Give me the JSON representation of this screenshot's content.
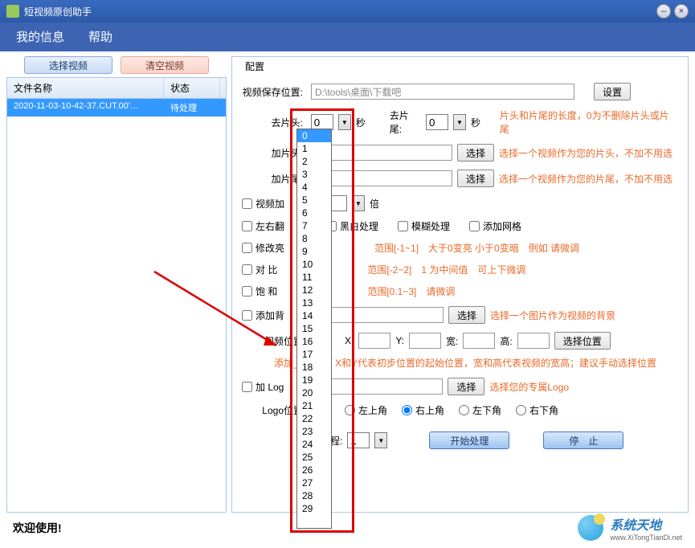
{
  "title": "短视频原创助手",
  "menu": {
    "info": "我的信息",
    "help": "帮助"
  },
  "leftButtons": {
    "select": "选择视频",
    "clear": "清空视频"
  },
  "fileTable": {
    "headers": {
      "name": "文件名称",
      "status": "状态"
    },
    "rows": [
      {
        "name": "2020-11-03-10-42-37.CUT.00'…",
        "status": "待处理"
      }
    ]
  },
  "config": {
    "groupTitle": "配置",
    "savePath": {
      "label": "视频保存位置:",
      "value": "D:\\tools\\桌面\\下载吧",
      "btn": "设置"
    },
    "trimHead": {
      "label": "去片头:",
      "value": "0",
      "unit": "秒"
    },
    "trimTail": {
      "label": "去片尾:",
      "value": "0",
      "unit": "秒",
      "hint": "片头和片尾的长度，0为不删除片头或片尾"
    },
    "addHead": {
      "label": "加片头:",
      "btn": "选择",
      "hint": "选择一个视频作为您的片头，不加不用选"
    },
    "addTail": {
      "label": "加片尾:",
      "btn": "选择",
      "hint": "选择一个视频作为您的片尾，不加不用选"
    },
    "speed": {
      "label": "视频加",
      "unit": "倍"
    },
    "flip": {
      "label": "左右翻"
    },
    "bw": {
      "label": "黑白处理"
    },
    "blur": {
      "label": "模糊处理"
    },
    "grid": {
      "label": "添加网格"
    },
    "brightness": {
      "label": "修改亮",
      "hint": "范围[-1~1]　大于0变亮 小于0变暗　例如 请微调"
    },
    "contrast": {
      "label": "对  比",
      "hint": "范围[-2~2]　1 为中间值　可上下微调"
    },
    "saturation": {
      "label": "饱 和",
      "hint": "范围[0.1~3]　请微调"
    },
    "bg": {
      "label": "添加背",
      "btn": "选择",
      "hint": "选择一个图片作为视频的背景"
    },
    "pos": {
      "label": "视频位置",
      "x": "X:",
      "y": "Y:",
      "w": "宽:",
      "h": "高:",
      "btn": "选择位置",
      "hint": "添加______：X和Y代表初步位置的起始位置，宽和高代表视频的宽高；建议手动选择位置"
    },
    "logo": {
      "label": "加 Log",
      "btn": "选择",
      "hint": "选择您的专属Logo"
    },
    "logoPos": {
      "label": "Logo位置",
      "options": [
        "左上角",
        "右上角",
        "左下角",
        "右下角"
      ],
      "selected": 1
    },
    "threads": {
      "label": "线程:",
      "value": "1"
    },
    "start": "开始处理",
    "stop": "停　止"
  },
  "dropdown": {
    "options": [
      "0",
      "1",
      "2",
      "3",
      "4",
      "5",
      "6",
      "7",
      "8",
      "9",
      "10",
      "11",
      "12",
      "13",
      "14",
      "15",
      "16",
      "17",
      "18",
      "19",
      "20",
      "21",
      "22",
      "23",
      "24",
      "25",
      "26",
      "27",
      "28",
      "29"
    ],
    "selected": 0
  },
  "footer": {
    "welcome": "欢迎使用!",
    "brand": "系统天地",
    "brandSub": "www.XiTongTianDi.net"
  }
}
